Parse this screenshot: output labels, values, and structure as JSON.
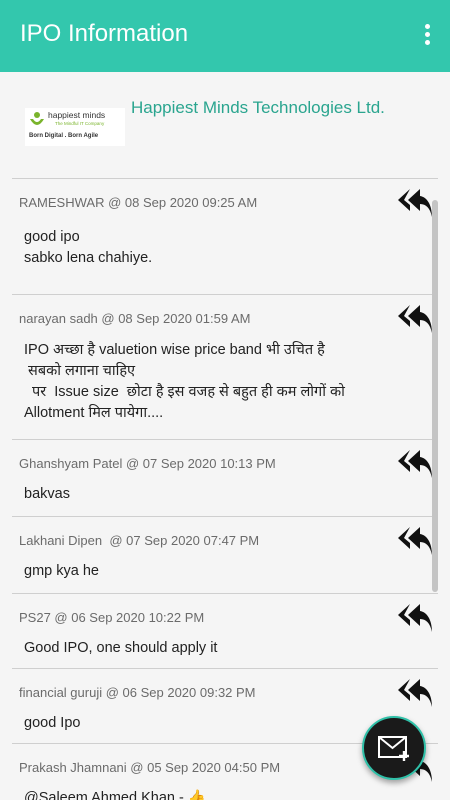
{
  "appbar": {
    "title": "IPO Information",
    "menu_icon": "more-vert-icon"
  },
  "company": {
    "name": "Happiest Minds Technologies Ltd.",
    "logo": {
      "line1": "happiest minds",
      "line2": "The Mindful IT Company",
      "line3": "Born Digital . Born Agile"
    }
  },
  "comments": [
    {
      "meta": "RAMESHWAR @ 08 Sep 2020 09:25 AM",
      "lines": [
        "good  ipo",
        "sabko lena chahiye."
      ]
    },
    {
      "meta": "narayan sadh @ 08 Sep 2020 01:59 AM",
      "lines": [
        "IPO अच्छा है  valuetion wise price band  भी उचित है",
        " सबको लगाना चाहिए",
        "  पर  Issue size  छोटा है इस वजह से बहुत ही कम लोगों को",
        "Allotment  मिल पायेगा...."
      ]
    },
    {
      "meta": "Ghanshyam Patel @ 07 Sep 2020 10:13 PM",
      "lines": [
        "bakvas"
      ]
    },
    {
      "meta": "Lakhani Dipen  @ 07 Sep 2020 07:47 PM",
      "lines": [
        "gmp kya he"
      ]
    },
    {
      "meta": "PS27 @ 06 Sep 2020 10:22 PM",
      "lines": [
        "Good IPO, one should apply it"
      ]
    },
    {
      "meta": "financial guruji @ 06 Sep 2020 09:32 PM",
      "lines": [
        "good Ipo"
      ]
    },
    {
      "meta": "Prakash Jhamnani @ 05 Sep 2020 04:50 PM",
      "lines": [
        "@Saleem Ahmed Khan - 👍"
      ]
    }
  ],
  "fab": {
    "icon": "compose-mail-icon"
  },
  "colors": {
    "accent": "#33c7ad",
    "company_name": "#2aa58f",
    "fab": "#1a1a1a"
  }
}
